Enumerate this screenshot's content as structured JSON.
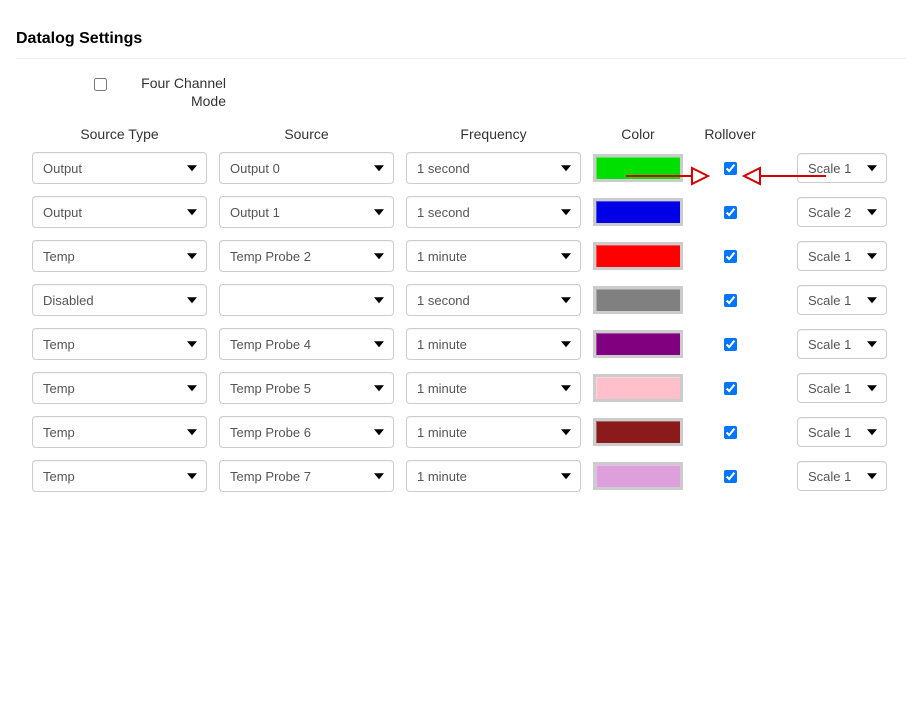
{
  "title": "Datalog Settings",
  "mode": {
    "label": "Four Channel Mode",
    "checked": false
  },
  "headers": {
    "sourceType": "Source Type",
    "source": "Source",
    "frequency": "Frequency",
    "color": "Color",
    "rollover": "Rollover"
  },
  "rows": [
    {
      "sourceType": "Output",
      "source": "Output 0",
      "frequency": "1 second",
      "color": "#00e000",
      "rollover": true,
      "scale": "Scale 1"
    },
    {
      "sourceType": "Output",
      "source": "Output 1",
      "frequency": "1 second",
      "color": "#0000e6",
      "rollover": true,
      "scale": "Scale 2"
    },
    {
      "sourceType": "Temp",
      "source": "Temp Probe 2",
      "frequency": "1 minute",
      "color": "#ff0000",
      "rollover": true,
      "scale": "Scale 1"
    },
    {
      "sourceType": "Disabled",
      "source": "",
      "frequency": "1 second",
      "color": "#808080",
      "rollover": true,
      "scale": "Scale 1"
    },
    {
      "sourceType": "Temp",
      "source": "Temp Probe 4",
      "frequency": "1 minute",
      "color": "#800080",
      "rollover": true,
      "scale": "Scale 1"
    },
    {
      "sourceType": "Temp",
      "source": "Temp Probe 5",
      "frequency": "1 minute",
      "color": "#ffc0cb",
      "rollover": true,
      "scale": "Scale 1"
    },
    {
      "sourceType": "Temp",
      "source": "Temp Probe 6",
      "frequency": "1 minute",
      "color": "#8b1a1a",
      "rollover": true,
      "scale": "Scale 1"
    },
    {
      "sourceType": "Temp",
      "source": "Temp Probe 7",
      "frequency": "1 minute",
      "color": "#dda0dd",
      "rollover": true,
      "scale": "Scale 1"
    }
  ]
}
